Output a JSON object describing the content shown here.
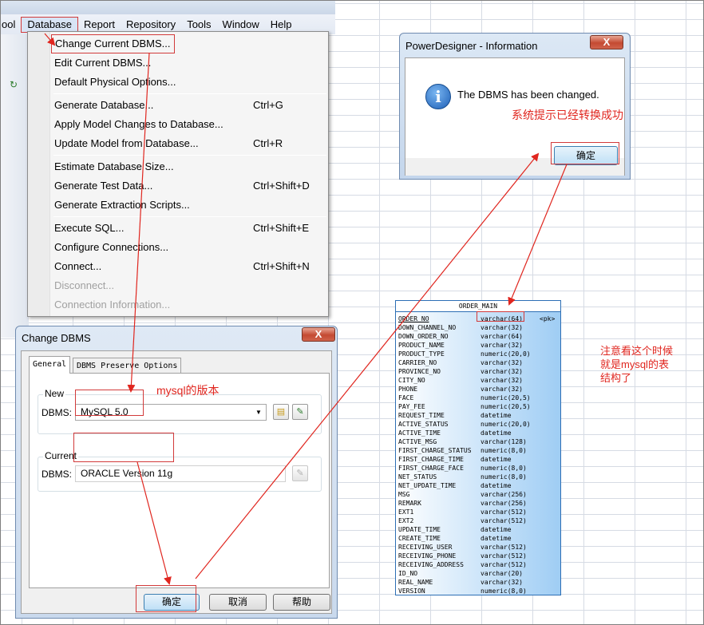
{
  "menubar": {
    "left_fragment": "ool",
    "items": [
      "Database",
      "Report",
      "Repository",
      "Tools",
      "Window",
      "Help"
    ]
  },
  "database_menu": {
    "groups": [
      [
        {
          "label": "Change Current DBMS...",
          "shortcut": "",
          "enabled": true
        },
        {
          "label": "Edit Current DBMS...",
          "shortcut": "",
          "enabled": true
        },
        {
          "label": "Default Physical Options...",
          "shortcut": "",
          "enabled": true
        }
      ],
      [
        {
          "label": "Generate Database...",
          "shortcut": "Ctrl+G",
          "enabled": true
        },
        {
          "label": "Apply Model Changes to Database...",
          "shortcut": "",
          "enabled": true
        },
        {
          "label": "Update Model from Database...",
          "shortcut": "Ctrl+R",
          "enabled": true
        }
      ],
      [
        {
          "label": "Estimate Database Size...",
          "shortcut": "",
          "enabled": true
        },
        {
          "label": "Generate Test Data...",
          "shortcut": "Ctrl+Shift+D",
          "enabled": true
        },
        {
          "label": "Generate Extraction Scripts...",
          "shortcut": "",
          "enabled": true
        }
      ],
      [
        {
          "label": "Execute SQL...",
          "shortcut": "Ctrl+Shift+E",
          "enabled": true
        },
        {
          "label": "Configure Connections...",
          "shortcut": "",
          "enabled": true
        },
        {
          "label": "Connect...",
          "shortcut": "Ctrl+Shift+N",
          "enabled": true
        },
        {
          "label": "Disconnect...",
          "shortcut": "",
          "enabled": false
        },
        {
          "label": "Connection Information...",
          "shortcut": "",
          "enabled": false
        }
      ]
    ]
  },
  "change_dbms_dialog": {
    "title": "Change DBMS",
    "close": "X",
    "tabs": [
      "General",
      "DBMS Preserve Options"
    ],
    "new_group_label": "New",
    "new_dbms_label": "DBMS:",
    "new_dbms_value": "MySQL 5.0",
    "current_group_label": "Current",
    "current_dbms_label": "DBMS:",
    "current_dbms_value": "ORACLE Version 11g",
    "buttons": {
      "ok": "确定",
      "cancel": "取消",
      "help": "帮助"
    }
  },
  "info_dialog": {
    "title": "PowerDesigner - Information",
    "close": "X",
    "icon_glyph": "i",
    "message": "The DBMS has been changed.",
    "ok": "确定"
  },
  "annotations": {
    "mysql_version": "mysql的版本",
    "success": "系统提示已经转换成功",
    "note_line1": "注意看这个时候",
    "note_line2": "就是mysql的表",
    "note_line3": "结构了"
  },
  "table": {
    "name": "ORDER_MAIN",
    "columns": [
      {
        "name": "ORDER_NO",
        "type": "varchar(64)",
        "key": "<pk>"
      },
      {
        "name": "DOWN_CHANNEL_NO",
        "type": "varchar(32)",
        "key": ""
      },
      {
        "name": "DOWN_ORDER_NO",
        "type": "varchar(64)",
        "key": ""
      },
      {
        "name": "PRODUCT_NAME",
        "type": "varchar(32)",
        "key": ""
      },
      {
        "name": "PRODUCT_TYPE",
        "type": "numeric(20,0)",
        "key": ""
      },
      {
        "name": "CARRIER_NO",
        "type": "varchar(32)",
        "key": ""
      },
      {
        "name": "PROVINCE_NO",
        "type": "varchar(32)",
        "key": ""
      },
      {
        "name": "CITY_NO",
        "type": "varchar(32)",
        "key": ""
      },
      {
        "name": "PHONE",
        "type": "varchar(32)",
        "key": ""
      },
      {
        "name": "FACE",
        "type": "numeric(20,5)",
        "key": ""
      },
      {
        "name": "PAY_FEE",
        "type": "numeric(20,5)",
        "key": ""
      },
      {
        "name": "REQUEST_TIME",
        "type": "datetime",
        "key": ""
      },
      {
        "name": "ACTIVE_STATUS",
        "type": "numeric(20,0)",
        "key": ""
      },
      {
        "name": "ACTIVE_TIME",
        "type": "datetime",
        "key": ""
      },
      {
        "name": "ACTIVE_MSG",
        "type": "varchar(128)",
        "key": ""
      },
      {
        "name": "FIRST_CHARGE_STATUS",
        "type": "numeric(8,0)",
        "key": ""
      },
      {
        "name": "FIRST_CHARGE_TIME",
        "type": "datetime",
        "key": ""
      },
      {
        "name": "FIRST_CHARGE_FACE",
        "type": "numeric(8,0)",
        "key": ""
      },
      {
        "name": "NET_STATUS",
        "type": "numeric(8,0)",
        "key": ""
      },
      {
        "name": "NET_UPDATE_TIME",
        "type": "datetime",
        "key": ""
      },
      {
        "name": "MSG",
        "type": "varchar(256)",
        "key": ""
      },
      {
        "name": "REMARK",
        "type": "varchar(256)",
        "key": ""
      },
      {
        "name": "EXT1",
        "type": "varchar(512)",
        "key": ""
      },
      {
        "name": "EXT2",
        "type": "varchar(512)",
        "key": ""
      },
      {
        "name": "UPDATE_TIME",
        "type": "datetime",
        "key": ""
      },
      {
        "name": "CREATE_TIME",
        "type": "datetime",
        "key": ""
      },
      {
        "name": "RECEIVING_USER",
        "type": "varchar(512)",
        "key": ""
      },
      {
        "name": "RECEIVING_PHONE",
        "type": "varchar(512)",
        "key": ""
      },
      {
        "name": "RECEIVING_ADDRESS",
        "type": "varchar(512)",
        "key": ""
      },
      {
        "name": "ID_NO",
        "type": "varchar(20)",
        "key": ""
      },
      {
        "name": "REAL_NAME",
        "type": "varchar(32)",
        "key": ""
      },
      {
        "name": "VERSION",
        "type": "numeric(8,0)",
        "key": ""
      }
    ]
  },
  "colors": {
    "annotation_red": "#e0261f",
    "table_border": "#2d6fb5"
  }
}
